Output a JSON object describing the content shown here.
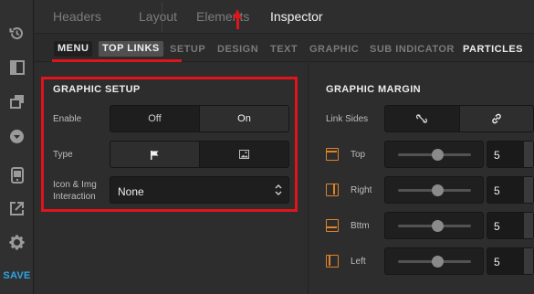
{
  "top_tabs": [
    "Headers",
    "Layout",
    "Elements",
    "Inspector"
  ],
  "sub_tabs": {
    "menu": "MENU",
    "top_links": "TOP LINKS",
    "others": [
      "SETUP",
      "DESIGN",
      "TEXT",
      "GRAPHIC",
      "SUB INDICATOR",
      "PARTICLES"
    ]
  },
  "sidebar": {
    "icons": [
      "history-icon",
      "panel-icon",
      "layers-icon",
      "down-circle-icon",
      "mobile-icon",
      "export-icon",
      "gear-icon"
    ],
    "save_label": "SAVE"
  },
  "graphic_setup": {
    "title": "GRAPHIC SETUP",
    "enable": {
      "label": "Enable",
      "options": [
        "Off",
        "On"
      ],
      "selected": "On"
    },
    "type": {
      "label": "Type",
      "options": [
        "flag-icon",
        "image-icon"
      ],
      "selected": "flag-icon"
    },
    "interaction": {
      "label_line1": "Icon & Img",
      "label_line2": "Interaction",
      "value": "None"
    }
  },
  "graphic_margin": {
    "title": "GRAPHIC MARGIN",
    "link_sides_label": "Link Sides",
    "sides": [
      {
        "label": "Top",
        "value": "5",
        "slider_fraction": 0.5
      },
      {
        "label": "Right",
        "value": "5",
        "slider_fraction": 0.5
      },
      {
        "label": "Bttm",
        "value": "5",
        "slider_fraction": 0.5
      },
      {
        "label": "Left",
        "value": "5",
        "slider_fraction": 0.5
      }
    ]
  },
  "colors": {
    "highlight": "#e0141b",
    "save": "#2fa6e5",
    "side_icon": "#e0822a"
  }
}
